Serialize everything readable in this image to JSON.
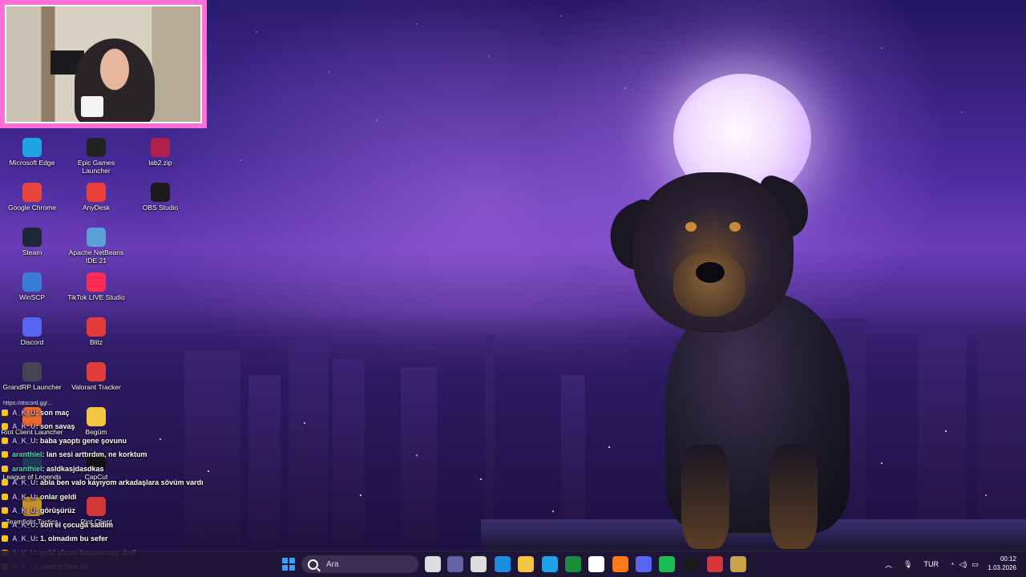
{
  "webcam": {
    "label": "streamer webcam"
  },
  "desktop_icons": [
    {
      "label": "Microsoft Edge",
      "icon": "edge-icon",
      "color": "#1fa3e6"
    },
    {
      "label": "Epic Games Launcher",
      "icon": "epic-icon",
      "color": "#222222"
    },
    {
      "label": "lab2.zip",
      "icon": "winrar-icon",
      "color": "#b0204a"
    },
    {
      "label": "Google Chrome",
      "icon": "chrome-icon",
      "color": "#e8453c"
    },
    {
      "label": "AnyDesk",
      "icon": "anydesk-icon",
      "color": "#e8403a"
    },
    {
      "label": "OBS Studio",
      "icon": "obs-icon",
      "color": "#1b1b1f"
    },
    {
      "label": "Steam",
      "icon": "steam-icon",
      "color": "#1b2838"
    },
    {
      "label": "Apache NetBeans IDE 21",
      "icon": "netbeans-icon",
      "color": "#5aa0d8"
    },
    {
      "label": "WinSCP",
      "icon": "winscp-icon",
      "color": "#3a7bd5"
    },
    {
      "label": "TikTok LIVE Studio",
      "icon": "tiktok-icon",
      "color": "#fe2c55"
    },
    {
      "label": "Discord",
      "icon": "discord-icon",
      "color": "#5865f2"
    },
    {
      "label": "Blitz",
      "icon": "blitz-icon",
      "color": "#e23b3b"
    },
    {
      "label": "GrandRP Launcher",
      "icon": "grandrp-icon",
      "color": "#444455"
    },
    {
      "label": "Valorant Tracker",
      "icon": "valorant-tracker-icon",
      "color": "#e03c3c"
    },
    {
      "label": "Riot Client Launcher",
      "icon": "riot-launcher-icon",
      "color": "#eb6a2c"
    },
    {
      "label": "Begüm",
      "icon": "folder-icon",
      "color": "#f4c542"
    },
    {
      "label": "League of Legends",
      "icon": "lol-icon",
      "color": "#1c3b56"
    },
    {
      "label": "CapCut",
      "icon": "capcut-icon",
      "color": "#111111"
    },
    {
      "label": "Teamfight Tactics",
      "icon": "tft-icon",
      "color": "#c8922a"
    },
    {
      "label": "Riot Client",
      "icon": "riot-client-icon",
      "color": "#d13639"
    }
  ],
  "chat": {
    "top_fragment": "https://discord.gg/...",
    "messages": [
      {
        "user": "A_K_U",
        "text": ": son maç"
      },
      {
        "user": "A_K_U",
        "text": ": son savaş"
      },
      {
        "user": "A_K_U",
        "text": ": baba yaoptı gene şovunu"
      },
      {
        "user": "aranthiel",
        "text": ": lan sesi arttırdım, ne korktum",
        "alt": true
      },
      {
        "user": "aranthiel",
        "text": ": asldkasjdasdkas",
        "alt": true
      },
      {
        "user": "A_K_U",
        "text": ": abla ben valo kayıyom arkadaşlara sövüm vardı"
      },
      {
        "user": "A_K_U",
        "text": ": onlar geldi"
      },
      {
        "user": "A_K_U",
        "text": ": görüşürüz"
      },
      {
        "user": "A_K_U",
        "text": ": son el çocuğa saldım"
      },
      {
        "user": "A_K_U",
        "text": ": 1. olmadım bu sefer"
      },
      {
        "user": "A_K_U",
        "text": ": gold olcam kazanırsam dedi"
      },
      {
        "user": "A_K_U",
        "text": ": saldım ben de"
      }
    ]
  },
  "taskbar": {
    "search_placeholder": "Ara",
    "apps": [
      {
        "icon": "windows-start-icon",
        "color": "#3aa0ff"
      },
      {
        "icon": "task-view-icon",
        "color": "#dddddd"
      },
      {
        "icon": "teams-icon",
        "color": "#6264a7"
      },
      {
        "icon": "store-icon",
        "color": "#dddddd"
      },
      {
        "icon": "help-icon",
        "color": "#1b8de0"
      },
      {
        "icon": "file-explorer-icon",
        "color": "#f4c542"
      },
      {
        "icon": "edge-icon",
        "color": "#1fa3e6"
      },
      {
        "icon": "excel-icon",
        "color": "#1d8c3f"
      },
      {
        "icon": "calculator-icon",
        "color": "#ffffff"
      },
      {
        "icon": "firefox-icon",
        "color": "#ff7a1a"
      },
      {
        "icon": "discord-icon",
        "color": "#5865f2"
      },
      {
        "icon": "spotify-icon",
        "color": "#1db954"
      },
      {
        "icon": "obs-icon",
        "color": "#1b1b1f"
      },
      {
        "icon": "riot-client-icon",
        "color": "#d13639"
      },
      {
        "icon": "lol-icon",
        "color": "#c8a24a"
      }
    ],
    "tray": {
      "language": "TUR",
      "time": "00:12",
      "date": "1.03.2026"
    }
  }
}
